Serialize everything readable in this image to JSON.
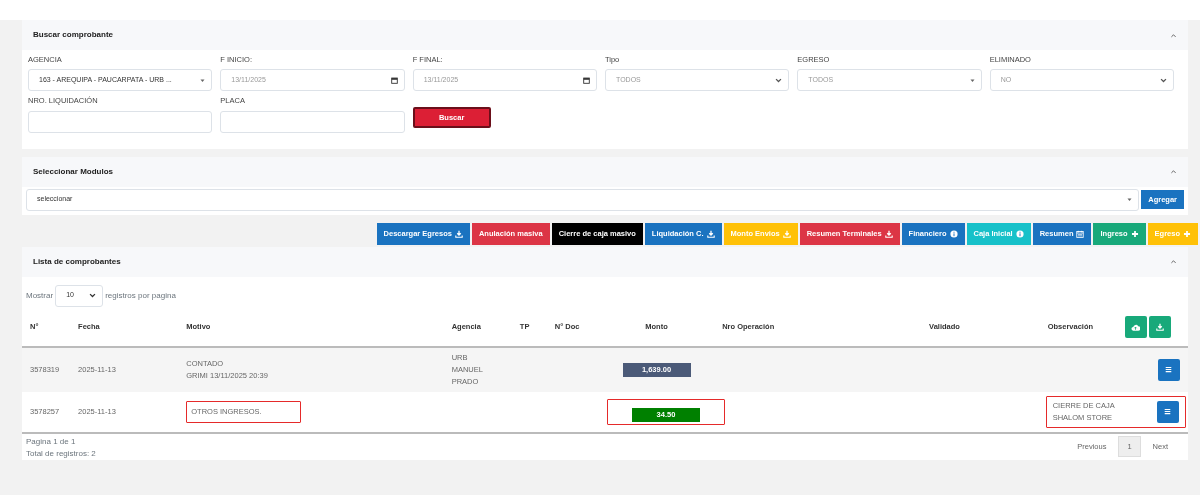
{
  "search_card": {
    "title": "Buscar comprobante",
    "fields": [
      {
        "label": "AGENCIA",
        "kind": "combo",
        "value": "163 - AREQUIPA - PAUCARPATA - URB ..."
      },
      {
        "label": "F INICIO:",
        "kind": "date",
        "value": "13/11/2025"
      },
      {
        "label": "F FINAL:",
        "kind": "date",
        "value": "13/11/2025"
      },
      {
        "label": "Tipo",
        "kind": "select",
        "value": "TODOS"
      },
      {
        "label": "EGRESO",
        "kind": "combo",
        "value": "TODOS"
      },
      {
        "label": "ELIMINADO",
        "kind": "select",
        "value": "NO"
      },
      {
        "label": "NRO. LIQUIDACIÓN",
        "kind": "text"
      },
      {
        "label": "PLACA",
        "kind": "text"
      }
    ],
    "button": "Buscar"
  },
  "modules_card": {
    "title": "Seleccionar Modulos",
    "select_value": "seleccionar",
    "button": "Agregar"
  },
  "action_buttons": [
    {
      "label": "Descargar Egresos",
      "color": "#1a73c0",
      "kind": "download"
    },
    {
      "label": "Anulación masiva",
      "color": "#dc3545",
      "kind": "plain"
    },
    {
      "label": "Cierre de caja masivo",
      "color": "#000000",
      "kind": "plain"
    },
    {
      "label": "Liquidación C.",
      "color": "#1a73c0",
      "kind": "download"
    },
    {
      "label": "Monto Envios",
      "color": "#ffc107",
      "kind": "download"
    },
    {
      "label": "Resumen Terminales",
      "color": "#dc3545",
      "kind": "download"
    },
    {
      "label": "Financiero",
      "color": "#1a73c0",
      "kind": "info"
    },
    {
      "label": "Caja Inicial",
      "color": "#17c1c9",
      "kind": "info"
    },
    {
      "label": "Resumen",
      "color": "#1a73c0",
      "kind": "calendar"
    },
    {
      "label": "Ingreso",
      "color": "#18a97a",
      "kind": "add"
    },
    {
      "label": "Egreso",
      "color": "#ffc107",
      "kind": "add"
    }
  ],
  "list_card": {
    "title": "Lista de comprobantes",
    "show_label": "Mostrar",
    "page_size": "10",
    "per_page_label": "registros por pagina",
    "columns": [
      "N°",
      "Fecha",
      "Motivo",
      "Agencia",
      "TP",
      "N° Doc",
      "Monto",
      "Nro Operación",
      "Validado",
      "Observación"
    ],
    "rows": [
      {
        "number": "3578319",
        "date": "2025-11-13",
        "reason": [
          "CONTADO",
          "GRIMI 13/11/2025 20:39"
        ],
        "agency": [
          "URB",
          "MANUEL",
          "PRADO"
        ],
        "amount": "1,639.00",
        "color": "#4b5a78",
        "observation": [],
        "reason_highlighted": false,
        "amount_highlighted": false,
        "observation_highlighted": false
      },
      {
        "number": "3578257",
        "date": "2025-11-13",
        "reason": [
          "OTROS INGRESOS."
        ],
        "agency": [],
        "amount": "34.50",
        "color": "#008000",
        "observation": [
          "CIERRE DE CAJA",
          "SHALOM STORE"
        ],
        "reason_highlighted": true,
        "amount_highlighted": true,
        "observation_highlighted": true
      }
    ],
    "page_info": "Pagina 1 de 1",
    "total": "Total de registros: 2",
    "pagination": [
      {
        "label": "Previous",
        "selected": false
      },
      {
        "label": "1",
        "selected": true
      },
      {
        "label": "Next",
        "selected": false
      }
    ]
  }
}
